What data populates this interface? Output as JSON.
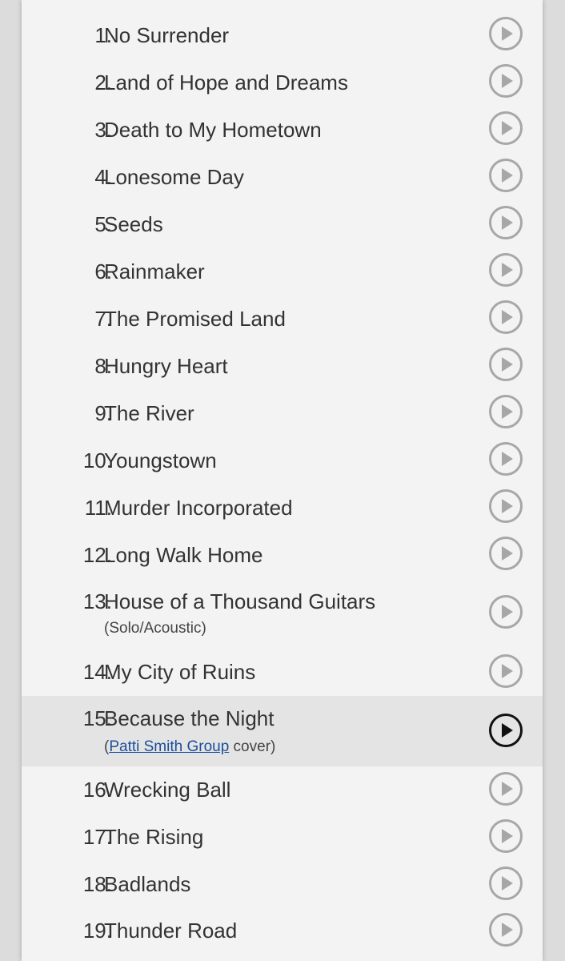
{
  "setlist": {
    "songs": [
      {
        "number": "1.",
        "title": "No Surrender"
      },
      {
        "number": "2.",
        "title": "Land of Hope and Dreams"
      },
      {
        "number": "3.",
        "title": "Death to My Hometown"
      },
      {
        "number": "4.",
        "title": "Lonesome Day"
      },
      {
        "number": "5.",
        "title": "Seeds"
      },
      {
        "number": "6.",
        "title": "Rainmaker"
      },
      {
        "number": "7.",
        "title": "The Promised Land"
      },
      {
        "number": "8.",
        "title": "Hungry Heart"
      },
      {
        "number": "9.",
        "title": "The River"
      },
      {
        "number": "10.",
        "title": "Youngstown"
      },
      {
        "number": "11.",
        "title": "Murder Incorporated"
      },
      {
        "number": "12.",
        "title": "Long Walk Home"
      },
      {
        "number": "13.",
        "title": "House of a Thousand Guitars",
        "note": "(Solo/Acoustic)"
      },
      {
        "number": "14.",
        "title": "My City of Ruins"
      },
      {
        "number": "15.",
        "title": "Because the Night",
        "note_prefix": "(",
        "note_link": "Patti Smith Group",
        "note_suffix": " cover)",
        "highlighted": true
      },
      {
        "number": "16.",
        "title": "Wrecking Ball"
      },
      {
        "number": "17.",
        "title": "The Rising"
      },
      {
        "number": "18.",
        "title": "Badlands"
      },
      {
        "number": "19.",
        "title": "Thunder Road"
      }
    ],
    "play_icon": "play-circle-icon",
    "colors": {
      "text": "#333333",
      "link": "#1a4f9c",
      "play_inactive": "#a7a7a7",
      "play_active": "#111111",
      "highlight_row": "#e4e4e4"
    }
  }
}
